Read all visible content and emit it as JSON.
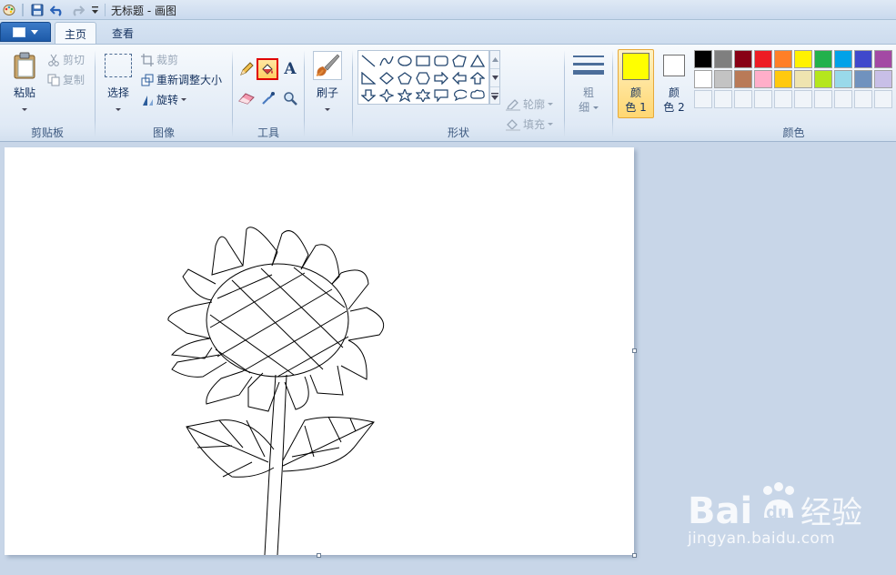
{
  "window": {
    "title": "无标题 - 画图"
  },
  "quick_access": {
    "icons": [
      "paint-app-icon",
      "save-icon",
      "undo-icon",
      "redo-icon",
      "customize-dropdown-icon"
    ]
  },
  "tabs": [
    {
      "label": "主页",
      "active": true
    },
    {
      "label": "查看",
      "active": false
    }
  ],
  "clipboard": {
    "paste": "粘贴",
    "cut": "剪切",
    "copy": "复制",
    "group": "剪贴板"
  },
  "image": {
    "select": "选择",
    "crop": "裁剪",
    "resize": "重新调整大小",
    "rotate": "旋转",
    "group": "图像"
  },
  "tools": {
    "group": "工具",
    "selected": "fill-bucket",
    "text_glyph": "A"
  },
  "brushes": {
    "label": "刷子"
  },
  "shapes": {
    "outline": "轮廓",
    "fill": "填充",
    "group": "形状"
  },
  "size": {
    "label_line1": "粗",
    "label_line2": "细"
  },
  "colors": {
    "color1": {
      "label_line1": "颜",
      "label_line2": "色 1",
      "value": "#ffff00"
    },
    "color2": {
      "label_line1": "颜",
      "label_line2": "色 2",
      "value": "#ffffff"
    },
    "group": "颜色",
    "palette_row1": [
      "#000000",
      "#7f7f7f",
      "#880015",
      "#ed1c24",
      "#ff7f27",
      "#fff200",
      "#22b14c",
      "#00a2e8",
      "#3f48cc",
      "#a349a4"
    ],
    "palette_row2": [
      "#ffffff",
      "#c3c3c3",
      "#b97a57",
      "#ffaec9",
      "#ffc90e",
      "#efe4b0",
      "#b5e61d",
      "#99d9ea",
      "#7092be",
      "#c8bfe7"
    ],
    "empty_slots": 10
  },
  "watermark": {
    "brand": "Bai",
    "paw": "du",
    "product": "经验",
    "url": "jingyan.baidu.com"
  }
}
